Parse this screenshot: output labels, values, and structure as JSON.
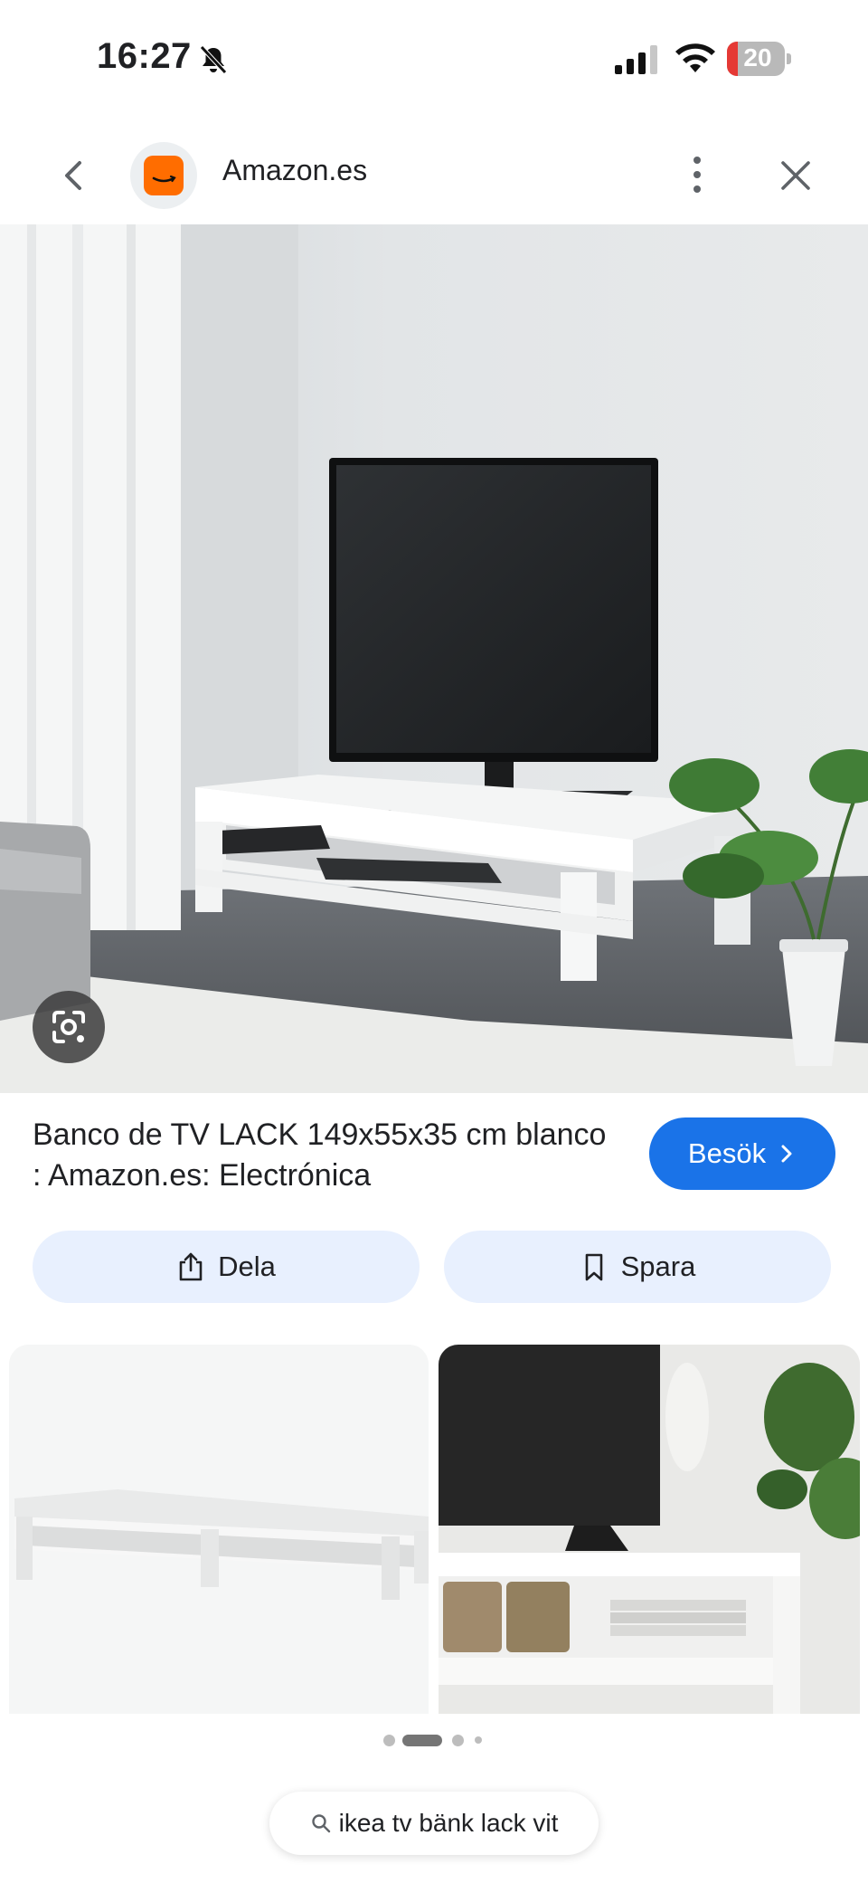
{
  "status_bar": {
    "time": "16:27",
    "battery_level": "20",
    "silent_icon": "bell-slash-icon",
    "signal_icon": "cellular-signal-icon",
    "wifi_icon": "wifi-icon"
  },
  "toolbar": {
    "back_icon": "chevron-left-icon",
    "site_name": "Amazon.es",
    "menu_icon": "more-vertical-icon",
    "close_icon": "close-icon"
  },
  "result": {
    "title": "Banco de TV LACK 149x55x35 cm blanco : Amazon.es: Electrónica",
    "visit_label": "Besök",
    "share_label": "Dela",
    "save_label": "Spara"
  },
  "pager": {
    "count": 4,
    "active_index": 1
  },
  "search": {
    "query": "ikea tv bänk lack vit"
  },
  "colors": {
    "accent": "#1a73e8",
    "chip_background": "#e8f0fe",
    "amazon_orange": "#ff6d00"
  }
}
